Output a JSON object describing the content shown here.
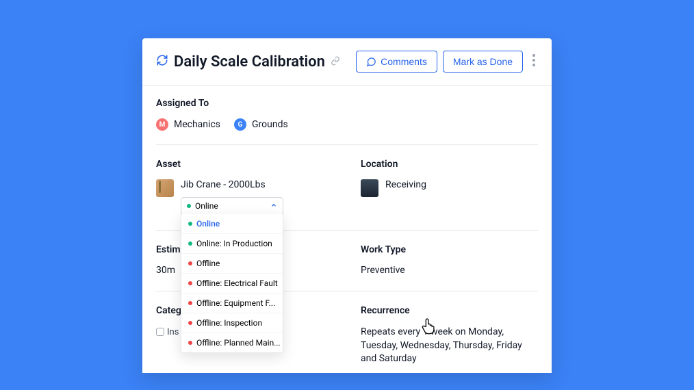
{
  "header": {
    "title": "Daily Scale Calibration",
    "comments_label": "Comments",
    "done_label": "Mark as Done"
  },
  "assigned": {
    "label": "Assigned To",
    "items": [
      {
        "initial": "M",
        "name": "Mechanics",
        "color": "#f87171"
      },
      {
        "initial": "G",
        "name": "Grounds",
        "color": "#3b82f6"
      }
    ]
  },
  "asset": {
    "label": "Asset",
    "name": "Jib Crane - 2000Lbs",
    "status_selected": "Online",
    "dropdown": [
      {
        "label": "Online",
        "dot": "green",
        "selected": true
      },
      {
        "label": "Online: In Production",
        "dot": "green"
      },
      {
        "label": "Offline",
        "dot": "red"
      },
      {
        "label": "Offline: Electrical Fault",
        "dot": "red"
      },
      {
        "label": "Offline: Equipment F...",
        "dot": "red"
      },
      {
        "label": "Offline: Inspection",
        "dot": "red"
      },
      {
        "label": "Offline: Planned Main...",
        "dot": "red"
      }
    ]
  },
  "location": {
    "label": "Location",
    "name": "Receiving"
  },
  "estimated": {
    "label": "Estim",
    "value": "30m"
  },
  "work_type": {
    "label": "Work Type",
    "value": "Preventive"
  },
  "category": {
    "label": "Categ",
    "value": "Ins"
  },
  "recurrence": {
    "label": "Recurrence",
    "value": "Repeats every 1 week on Monday, Tuesday, Wednesday, Thursday, Friday and Saturday"
  }
}
